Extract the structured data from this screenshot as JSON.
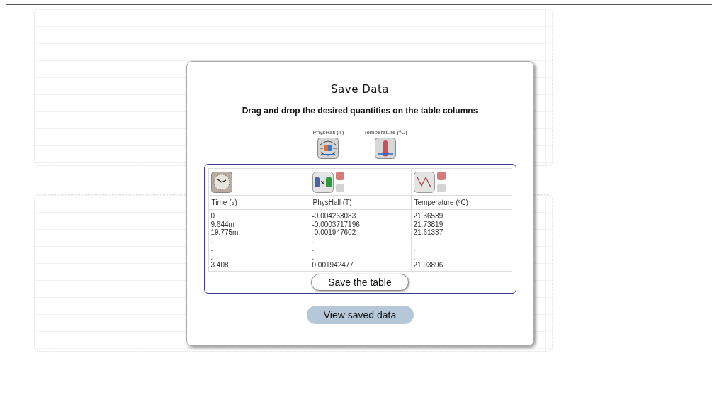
{
  "dialog": {
    "title": "Save Data",
    "instruction": "Drag and drop the desired quantities on the table columns",
    "quantities": [
      {
        "label": "PhysHall (T)",
        "kind": "hall-probe"
      },
      {
        "label": "Temperature (ºC)",
        "kind": "thermometer"
      }
    ],
    "table": {
      "columns": [
        {
          "kind": "time",
          "name": "Time (s)",
          "values": [
            "0",
            "9.644m",
            "19.775m",
            ".",
            ".",
            ".",
            "3.408"
          ]
        },
        {
          "kind": "product",
          "name": "PhysHall (T)",
          "values": [
            "-0.004263083",
            "-0.0003717196",
            "-0.001947602",
            ".",
            ".",
            ".",
            "0.001942477"
          ]
        },
        {
          "kind": "plot",
          "name": "Temperature (ºC)",
          "values": [
            "21.36539",
            "21.73819",
            "21.61337",
            ".",
            ".",
            ".",
            "21.93896"
          ]
        }
      ]
    },
    "save_button": "Save the table",
    "view_button": "View saved data"
  }
}
